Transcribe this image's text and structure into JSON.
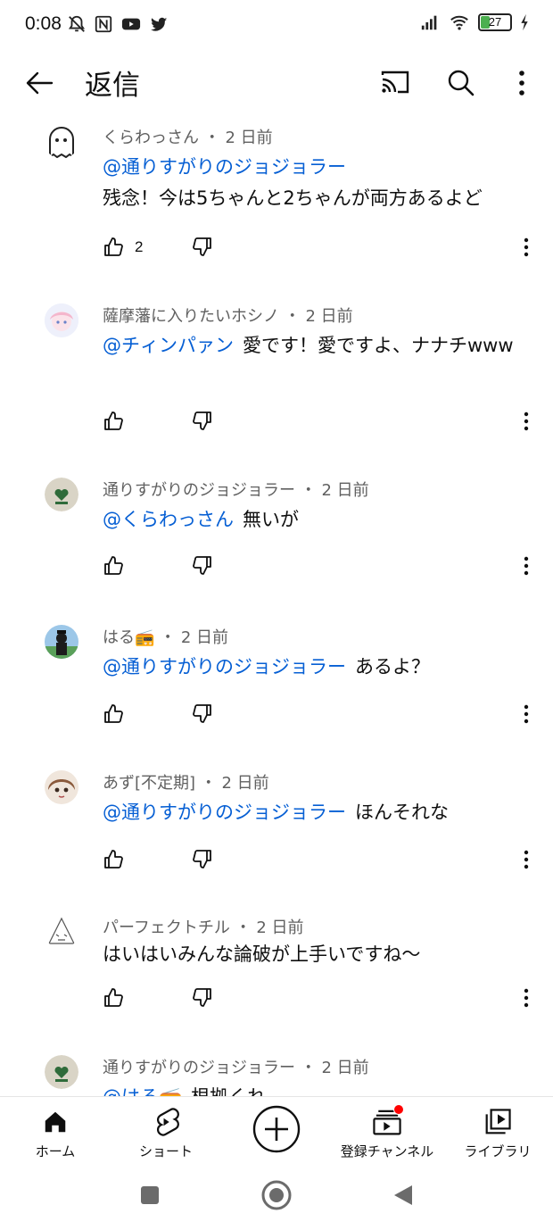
{
  "status_bar": {
    "time": "0:08",
    "battery": "27"
  },
  "app_bar": {
    "title": "返信"
  },
  "comments": [
    {
      "author": "くらわっさん",
      "age": "2 日前",
      "mention": "@通りすがりのジョジョラー",
      "text": "残念！今は5ちゃんと2ちゃんが両方あるよど",
      "likes": "2"
    },
    {
      "author": "薩摩藩に入りたいホシノ",
      "age": "2 日前",
      "mention": "@チィンパァン",
      "text": "愛です！愛ですよ、ナナチwww",
      "likes": ""
    },
    {
      "author": "通りすがりのジョジョラー",
      "age": "2 日前",
      "mention": "@くらわっさん",
      "text": "無いが",
      "likes": ""
    },
    {
      "author": "はる📻",
      "age": "2 日前",
      "mention": "@通りすがりのジョジョラー",
      "text": "あるよ？",
      "likes": ""
    },
    {
      "author": "あず[不定期]",
      "age": "2 日前",
      "mention": "@通りすがりのジョジョラー",
      "text": "ほんそれな",
      "likes": ""
    },
    {
      "author": "パーフェクトチル",
      "age": "2 日前",
      "mention": "",
      "text": "はいはいみんな論破が上手いですね〜",
      "likes": ""
    },
    {
      "author": "通りすがりのジョジョラー",
      "age": "2 日前",
      "mention": "@はる📻",
      "text": "根拠くれ",
      "likes": ""
    }
  ],
  "bottom_nav": {
    "home": "ホーム",
    "shorts": "ショート",
    "subscriptions": "登録チャンネル",
    "library": "ライブラリ"
  },
  "colors": {
    "mention": "#065fd4",
    "meta": "#606060",
    "notification_dot": "#ff0000"
  }
}
